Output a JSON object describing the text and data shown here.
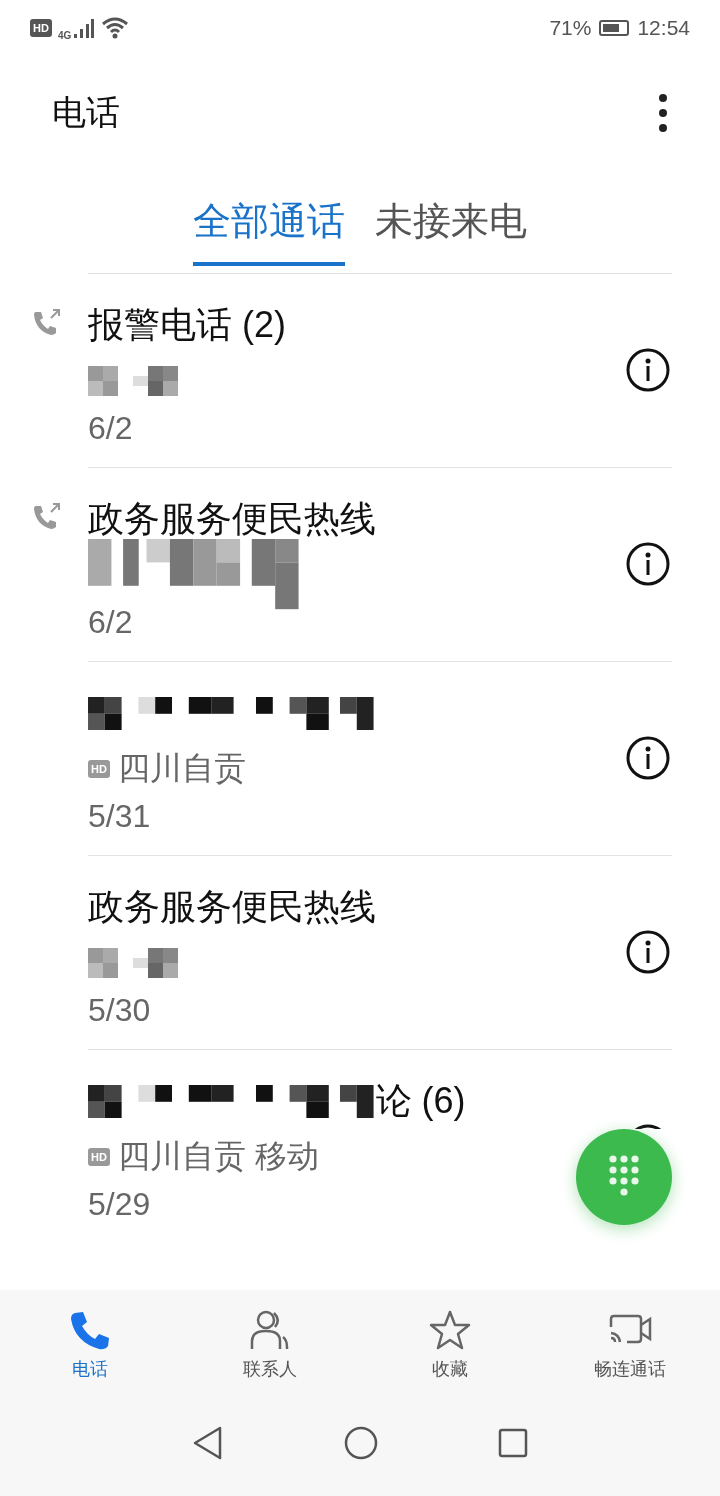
{
  "status_bar": {
    "hd_badge": "HD",
    "network": "4G",
    "battery": "71%",
    "time": "12:54"
  },
  "header": {
    "title": "电话"
  },
  "tabs": [
    {
      "label": "全部通话",
      "selected": true
    },
    {
      "label": "未接来电",
      "selected": false
    }
  ],
  "calls": [
    {
      "outgoing": true,
      "name": "报警电话 (2)",
      "name_redacted": false,
      "number_redacted": true,
      "date": "6/2"
    },
    {
      "outgoing": true,
      "name": "政务服务便民热线",
      "name_redacted": false,
      "number_redacted": true,
      "date": "6/2"
    },
    {
      "outgoing": false,
      "name_redacted": true,
      "number_redacted": false,
      "hd_badge": "HD",
      "location": "四川自贡",
      "date": "5/31"
    },
    {
      "outgoing": false,
      "name": "政务服务便民热线",
      "name_redacted": false,
      "number_redacted": true,
      "date": "5/30"
    },
    {
      "outgoing": false,
      "name": "论 (6)",
      "name_redacted": true,
      "number_redacted": false,
      "hd_badge": "HD",
      "location": "四川自贡 移动",
      "date": "5/29"
    }
  ],
  "bottom_nav": [
    {
      "label": "电话",
      "kind": "phone",
      "selected": true
    },
    {
      "label": "联系人",
      "kind": "contacts",
      "selected": false
    },
    {
      "label": "收藏",
      "kind": "star",
      "selected": false
    },
    {
      "label": "畅连通话",
      "kind": "video",
      "selected": false
    }
  ]
}
